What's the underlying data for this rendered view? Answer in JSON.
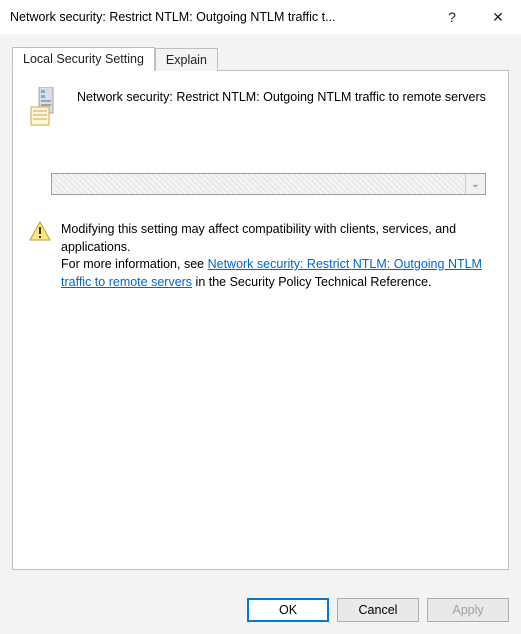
{
  "window": {
    "title": "Network security: Restrict NTLM: Outgoing NTLM traffic t...",
    "help_glyph": "?",
    "close_glyph": "✕"
  },
  "tabs": {
    "local": "Local Security Setting",
    "explain": "Explain"
  },
  "policy": {
    "heading": "Network security: Restrict NTLM: Outgoing NTLM traffic to remote servers",
    "dropdown_value": "",
    "dropdown_arrow": "⌄"
  },
  "warning": {
    "line1": "Modifying this setting may affect compatibility with clients, services, and applications.",
    "more_prefix": "For more information, see ",
    "link_text": "Network security: Restrict NTLM: Outgoing NTLM traffic to remote servers",
    "more_suffix": " in the Security Policy Technical Reference."
  },
  "buttons": {
    "ok": "OK",
    "cancel": "Cancel",
    "apply": "Apply"
  }
}
